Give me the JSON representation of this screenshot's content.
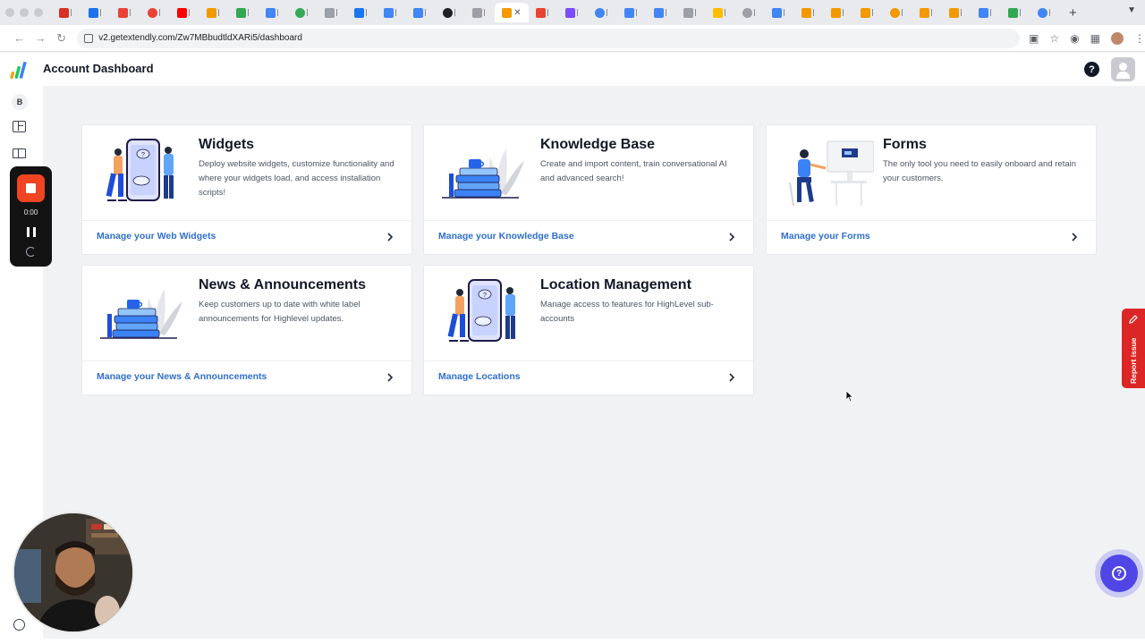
{
  "browser": {
    "url": "v2.getextendly.com/Zw7MBbudtldXARi5/dashboard",
    "tab_favicons": [
      "#d93025",
      "#1a73e8",
      "#ea4335",
      "#ea4335",
      "#ff0000",
      "#f29900",
      "#34a853",
      "#4285f4",
      "#34a853",
      "#9aa0a6",
      "#1877f2",
      "#4285f4",
      "#4285f4",
      "#202124",
      "#9aa0a6",
      "#f29900",
      "#ea4335",
      "#7c4dff",
      "#4285f4",
      "#4285f4",
      "#4285f4",
      "#9aa0a6",
      "#fbbc04",
      "#9aa0a6",
      "#4285f4",
      "#f29900",
      "#f29900",
      "#f29900",
      "#f29900",
      "#f29900",
      "#f29900",
      "#4285f4",
      "#34a853",
      "#4285f4"
    ]
  },
  "header": {
    "title": "Account Dashboard",
    "help": "?"
  },
  "sidebar": {
    "account_initial": "B"
  },
  "recorder": {
    "time": "0:00"
  },
  "cards": [
    {
      "title": "Widgets",
      "description": "Deploy website widgets, customize functionality and where your widgets load, and access installation scripts!",
      "link": "Manage your Web Widgets",
      "illustration": "phone-people"
    },
    {
      "title": "Knowledge Base",
      "description": "Create and import content, train conversational AI and advanced search!",
      "link": "Manage your Knowledge Base",
      "illustration": "books-plant"
    },
    {
      "title": "Forms",
      "description": "The only tool you need to easily onboard and retain your customers.",
      "link": "Manage your Forms",
      "illustration": "person-desk"
    },
    {
      "title": "News & Announcements",
      "description": "Keep customers up to date with white label announcements for Highlevel updates.",
      "link": "Manage your News & Announcements",
      "illustration": "books-plant"
    },
    {
      "title": "Location Management",
      "description": "Manage access to features for HighLevel sub-accounts",
      "link": "Manage Locations",
      "illustration": "phone-people"
    }
  ],
  "report_issue": "Report issue",
  "colors": {
    "link": "#2f6fcf",
    "report": "#dc2626",
    "help_bubble": "#4f46e5",
    "recorder_stop": "#f04423"
  }
}
